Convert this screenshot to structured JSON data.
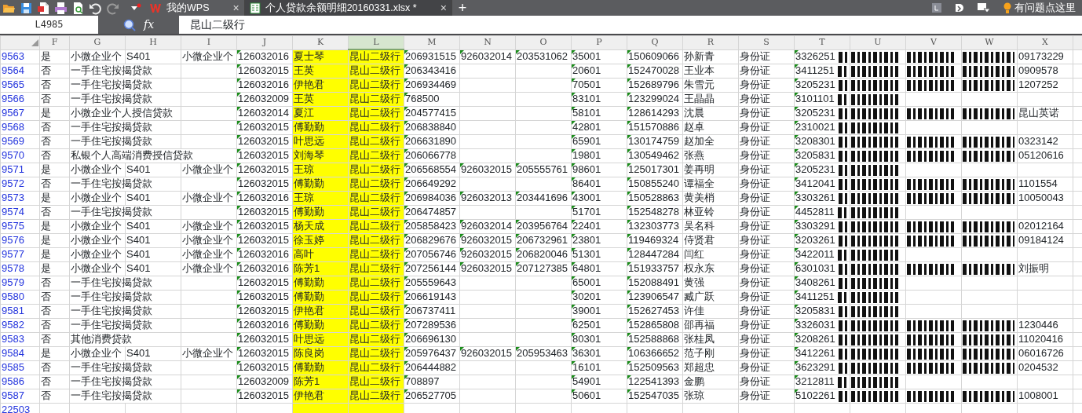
{
  "tabs": [
    {
      "label": "我的WPS",
      "selected": false,
      "kind": "home",
      "close": "×"
    },
    {
      "label": "个人贷款余额明细20160331.xlsx *",
      "selected": true,
      "kind": "sheet",
      "close": "×"
    }
  ],
  "new_tab": "+",
  "help": "有问题点这里",
  "formula_bar": {
    "cell": "L4985",
    "fx": "fx",
    "value": "昆山二级行"
  },
  "columns": [
    {
      "letter": "F",
      "selected": false
    },
    {
      "letter": "G",
      "selected": false
    },
    {
      "letter": "H",
      "selected": false
    },
    {
      "letter": "I",
      "selected": false
    },
    {
      "letter": "J",
      "selected": false,
      "number_as_text": true
    },
    {
      "letter": "K",
      "selected": false,
      "highlighted": true
    },
    {
      "letter": "L",
      "highlighted": true,
      "selected": true
    },
    {
      "letter": "M",
      "selected": false,
      "number_as_text": true
    },
    {
      "letter": "N",
      "selected": false,
      "number_as_text": true
    },
    {
      "letter": "O",
      "selected": false,
      "number_as_text": true
    },
    {
      "letter": "P",
      "selected": false,
      "number_as_text": true
    },
    {
      "letter": "Q",
      "selected": false,
      "number_as_text": true
    },
    {
      "letter": "R",
      "selected": false
    },
    {
      "letter": "S",
      "selected": false
    },
    {
      "letter": "T",
      "selected": false,
      "number_as_text": true
    },
    {
      "letter": "U",
      "selected": false
    },
    {
      "letter": "V",
      "selected": false
    },
    {
      "letter": "W",
      "selected": false
    },
    {
      "letter": "X",
      "selected": false
    }
  ],
  "rows": [
    {
      "num": "9563",
      "full_redaction": true,
      "cells": [
        "是",
        "小微企业个",
        "S401",
        "小微企业个",
        "126032016",
        "夏士琴",
        "昆山二级行",
        "206931515",
        "926032014",
        "203531062",
        "35001",
        "150609066",
        "孙新青",
        "身份证",
        "3326251",
        null,
        null,
        null,
        "09173229"
      ]
    },
    {
      "num": "9564",
      "full_redaction": true,
      "cells": [
        "否",
        "一手住宅按揭贷款",
        null,
        null,
        "126032015",
        "王英",
        "昆山二级行",
        "206343416",
        null,
        null,
        "20601",
        "152470028",
        "王业本",
        "身份证",
        "3411251",
        null,
        null,
        null,
        "0909578"
      ]
    },
    {
      "num": "9565",
      "full_redaction": true,
      "cells": [
        "否",
        "一手住宅按揭贷款",
        null,
        null,
        "126032016",
        "伊艳君",
        "昆山二级行",
        "206934469",
        null,
        null,
        "70501",
        "152689796",
        "朱雪元",
        "身份证",
        "3205231",
        null,
        null,
        null,
        "1207252"
      ]
    },
    {
      "num": "9566",
      "full_redaction": false,
      "cells": [
        "否",
        "一手住宅按揭贷款",
        null,
        null,
        "126032009",
        "王英",
        "昆山二级行",
        "768500",
        null,
        null,
        "83101",
        "123299024",
        "王晶晶",
        "身份证",
        "3101101",
        null,
        null,
        null,
        null
      ]
    },
    {
      "num": "9567",
      "full_redaction": true,
      "cells": [
        "是",
        "小微企业个人授信贷款",
        null,
        null,
        "126032014",
        "夏江",
        "昆山二级行",
        "204577415",
        null,
        null,
        "58101",
        "128614293",
        "沈晨",
        "身份证",
        "3205231",
        null,
        null,
        null,
        "昆山英诺"
      ]
    },
    {
      "num": "9568",
      "full_redaction": false,
      "cells": [
        "否",
        "一手住宅按揭贷款",
        null,
        null,
        "126032015",
        "傅勤勤",
        "昆山二级行",
        "206838840",
        null,
        null,
        "42801",
        "151570886",
        "赵卓",
        "身份证",
        "2310021",
        null,
        null,
        null,
        null
      ]
    },
    {
      "num": "9569",
      "full_redaction": true,
      "cells": [
        "否",
        "一手住宅按揭贷款",
        null,
        null,
        "126032015",
        "叶思远",
        "昆山二级行",
        "206631890",
        null,
        null,
        "65901",
        "130174759",
        "赵加全",
        "身份证",
        "3208301",
        null,
        null,
        null,
        "0323142"
      ]
    },
    {
      "num": "9570",
      "full_redaction": true,
      "cells": [
        "否",
        "私银个人高端消费授信贷款",
        null,
        null,
        "126032015",
        "刘海琴",
        "昆山二级行",
        "206066778",
        null,
        null,
        "19801",
        "130549462",
        "张燕",
        "身份证",
        "3205831",
        null,
        null,
        null,
        "05120616"
      ]
    },
    {
      "num": "9571",
      "full_redaction": false,
      "cells": [
        "是",
        "小微企业个",
        "S401",
        "小微企业个",
        "126032015",
        "王琼",
        "昆山二级行",
        "206568554",
        "926032015",
        "205555761",
        "98601",
        "125017301",
        "姜再明",
        "身份证",
        "3205231",
        null,
        null,
        null,
        null
      ]
    },
    {
      "num": "9572",
      "full_redaction": true,
      "cells": [
        "否",
        "一手住宅按揭贷款",
        null,
        null,
        "126032015",
        "傅勤勤",
        "昆山二级行",
        "206649292",
        null,
        null,
        "86401",
        "150855240",
        "谭福全",
        "身份证",
        "3412041",
        null,
        null,
        null,
        "1101554"
      ]
    },
    {
      "num": "9573",
      "full_redaction": true,
      "cells": [
        "是",
        "小微企业个",
        "S401",
        "小微企业个",
        "126032016",
        "王琼",
        "昆山二级行",
        "206984036",
        "926032013",
        "203441696",
        "43001",
        "150528863",
        "黄美梢",
        "身份证",
        "3303261",
        null,
        null,
        null,
        "10050043"
      ]
    },
    {
      "num": "9574",
      "full_redaction": false,
      "cells": [
        "否",
        "一手住宅按揭贷款",
        null,
        null,
        "126032015",
        "傅勤勤",
        "昆山二级行",
        "206474857",
        null,
        null,
        "51701",
        "152548278",
        "林亚铃",
        "身份证",
        "4452811",
        null,
        null,
        null,
        null
      ]
    },
    {
      "num": "9575",
      "full_redaction": true,
      "cells": [
        "是",
        "小微企业个",
        "S401",
        "小微企业个",
        "126032015",
        "杨天成",
        "昆山二级行",
        "205858423",
        "926032014",
        "203956764",
        "22401",
        "132303773",
        "吴名科",
        "身份证",
        "3303291",
        null,
        null,
        null,
        "02012164"
      ]
    },
    {
      "num": "9576",
      "full_redaction": true,
      "cells": [
        "是",
        "小微企业个",
        "S401",
        "小微企业个",
        "126032015",
        "徐玉婷",
        "昆山二级行",
        "206829676",
        "926032015",
        "206732961",
        "23801",
        "119469324",
        "侍贤君",
        "身份证",
        "3203261",
        null,
        null,
        null,
        "09184124"
      ]
    },
    {
      "num": "9577",
      "full_redaction": false,
      "cells": [
        "是",
        "小微企业个",
        "S401",
        "小微企业个",
        "126032016",
        "高叶",
        "昆山二级行",
        "207056746",
        "926032015",
        "206820046",
        "51301",
        "128447284",
        "闫红",
        "身份证",
        "3422011",
        null,
        null,
        null,
        null
      ]
    },
    {
      "num": "9578",
      "full_redaction": true,
      "cells": [
        "是",
        "小微企业个",
        "S401",
        "小微企业个",
        "126032016",
        "陈芳1",
        "昆山二级行",
        "207256144",
        "926032015",
        "207127385",
        "64801",
        "151933757",
        "权永东",
        "身份证",
        "6301031",
        null,
        null,
        null,
        "刘振明"
      ]
    },
    {
      "num": "9579",
      "full_redaction": false,
      "cells": [
        "否",
        "一手住宅按揭贷款",
        null,
        null,
        "126032015",
        "傅勤勤",
        "昆山二级行",
        "205559643",
        null,
        null,
        "65001",
        "152088491",
        "黄强",
        "身份证",
        "3408261",
        null,
        null,
        null,
        null
      ]
    },
    {
      "num": "9580",
      "full_redaction": false,
      "cells": [
        "否",
        "一手住宅按揭贷款",
        null,
        null,
        "126032015",
        "傅勤勤",
        "昆山二级行",
        "206619143",
        null,
        null,
        "30201",
        "123906547",
        "臧广跃",
        "身份证",
        "3411251",
        null,
        null,
        null,
        null
      ]
    },
    {
      "num": "9581",
      "full_redaction": false,
      "cells": [
        "否",
        "一手住宅按揭贷款",
        null,
        null,
        "126032015",
        "伊艳君",
        "昆山二级行",
        "206737411",
        null,
        null,
        "39001",
        "152627453",
        "许佳",
        "身份证",
        "3205831",
        null,
        null,
        null,
        null
      ]
    },
    {
      "num": "9582",
      "full_redaction": true,
      "cells": [
        "否",
        "一手住宅按揭贷款",
        null,
        null,
        "126032016",
        "傅勤勤",
        "昆山二级行",
        "207289536",
        null,
        null,
        "62501",
        "152865808",
        "邵再福",
        "身份证",
        "3326031",
        null,
        null,
        null,
        "1230446"
      ]
    },
    {
      "num": "9583",
      "full_redaction": true,
      "cells": [
        "否",
        "其他消费贷款",
        null,
        null,
        "126032015",
        "叶思远",
        "昆山二级行",
        "206696130",
        null,
        null,
        "80301",
        "152588868",
        "张桂凤",
        "身份证",
        "3208261",
        null,
        null,
        null,
        "11020416"
      ]
    },
    {
      "num": "9584",
      "full_redaction": true,
      "cells": [
        "是",
        "小微企业个",
        "S401",
        "小微企业个",
        "126032015",
        "陈良岗",
        "昆山二级行",
        "205976437",
        "926032015",
        "205953463",
        "36301",
        "106366652",
        "范子刚",
        "身份证",
        "3412261",
        null,
        null,
        null,
        "06016726"
      ]
    },
    {
      "num": "9585",
      "full_redaction": true,
      "cells": [
        "否",
        "一手住宅按揭贷款",
        null,
        null,
        "126032015",
        "傅勤勤",
        "昆山二级行",
        "206444882",
        null,
        null,
        "16101",
        "152509563",
        "郑超忠",
        "身份证",
        "3623291",
        null,
        null,
        null,
        "0204532"
      ]
    },
    {
      "num": "9586",
      "full_redaction": false,
      "cells": [
        "否",
        "一手住宅按揭贷款",
        null,
        null,
        "126032009",
        "陈芳1",
        "昆山二级行",
        "708897",
        null,
        null,
        "54901",
        "122541393",
        "金鹏",
        "身份证",
        "3212811",
        null,
        null,
        null,
        null
      ]
    },
    {
      "num": "9587",
      "full_redaction": true,
      "cells": [
        "否",
        "一手住宅按揭贷款",
        null,
        null,
        "126032015",
        "伊艳君",
        "昆山二级行",
        "206527705",
        null,
        null,
        "50601",
        "152547035",
        "张琼",
        "身份证",
        "5102261",
        null,
        null,
        null,
        "1008001"
      ]
    },
    {
      "num": "22503"
    }
  ]
}
